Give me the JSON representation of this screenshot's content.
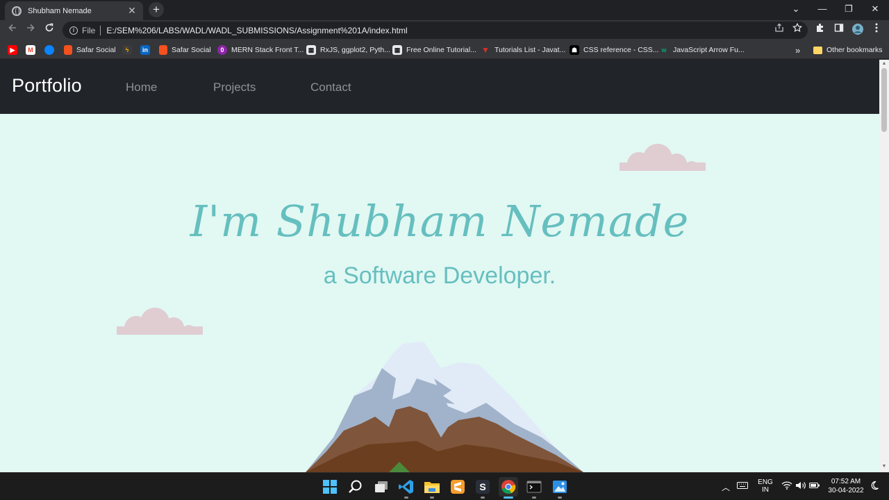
{
  "browser": {
    "tab_title": "Shubham Nemade",
    "tab_close": "✕",
    "new_tab": "+",
    "scheme_label": "File",
    "url": "E:/SEM%206/LABS/WADL/WADL_SUBMISSIONS/Assignment%201A/index.html",
    "window_controls": {
      "dropdown": "⌄",
      "minimize": "—",
      "restore": "❐",
      "close": "✕"
    }
  },
  "bookmarks": {
    "items": [
      {
        "label": "",
        "icon": "youtube-icon",
        "color": "#ff0000"
      },
      {
        "label": "",
        "icon": "gmail-icon",
        "color": "#ea4335"
      },
      {
        "label": "",
        "icon": "edge-icon",
        "color": "#0a84ff"
      },
      {
        "label": "Safar Social",
        "icon": "safar-icon",
        "color": "#f4511e"
      },
      {
        "label": "",
        "icon": "lightning-icon",
        "color": "#f9ab00"
      },
      {
        "label": "",
        "icon": "linkedin-icon",
        "color": "#0a66c2"
      },
      {
        "label": "Safar Social",
        "icon": "safar-icon",
        "color": "#f4511e"
      },
      {
        "label": "MERN Stack Front T...",
        "icon": "mern-icon",
        "color": "#8e24aa"
      },
      {
        "label": "RxJS, ggplot2, Pyth...",
        "icon": "rxjs-icon",
        "color": "#5f6368"
      },
      {
        "label": "Free Online Tutorial...",
        "icon": "tutorial-icon",
        "color": "#5f6368"
      },
      {
        "label": "Tutorials List - Javat...",
        "icon": "javatpoint-icon",
        "color": "#d93025"
      },
      {
        "label": "CSS reference - CSS...",
        "icon": "mdn-icon",
        "color": "#000000"
      },
      {
        "label": "JavaScript Arrow Fu...",
        "icon": "w3-icon",
        "color": "#04aa6d"
      }
    ],
    "overflow": "»",
    "other": "Other bookmarks"
  },
  "site": {
    "brand": "Portfolio",
    "nav": [
      "Home",
      "Projects",
      "Contact"
    ],
    "title": "I'm Shubham Nemade",
    "subtitle": "a Software Developer."
  },
  "colors": {
    "page_bg": "#e2f8f3",
    "accent": "#66bfbf",
    "nav_bg": "#212529",
    "cloud": "#dfcdd2"
  },
  "taskbar": {
    "apps": [
      "windows-start-icon",
      "search-icon",
      "task-view-icon",
      "vscode-icon",
      "file-explorer-icon",
      "sublime-icon",
      "s-app-icon",
      "chrome-icon",
      "terminal-icon",
      "photos-icon"
    ],
    "lang_top": "ENG",
    "lang_bottom": "IN",
    "time": "07:52 AM",
    "date": "30-04-2022"
  }
}
